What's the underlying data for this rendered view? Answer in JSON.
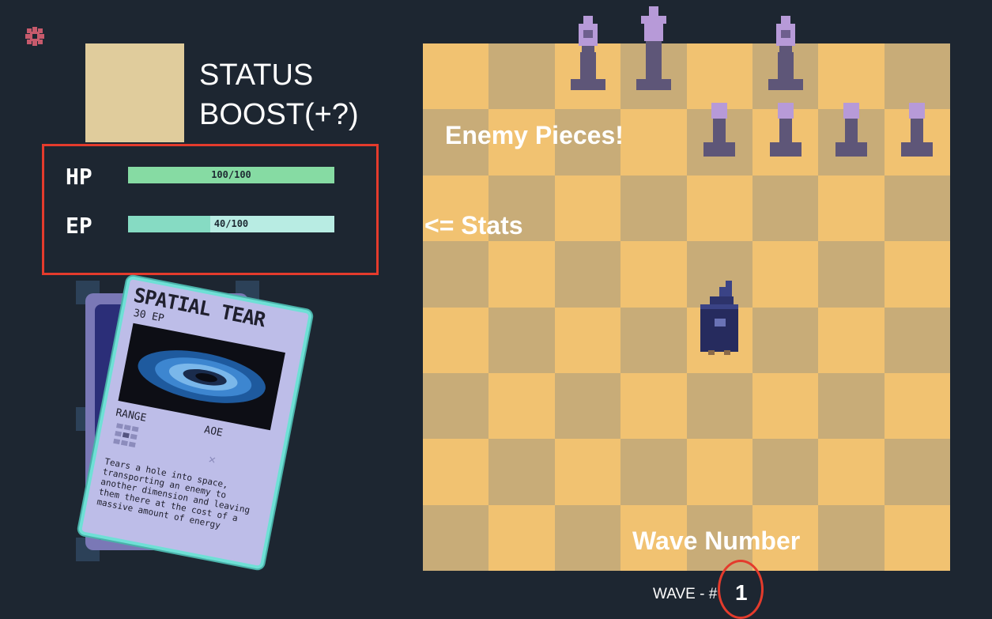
{
  "settings": {
    "icon": "gear-icon",
    "color": "#c75a6c"
  },
  "status_boost": {
    "text": "STATUS BOOST(+?)",
    "swatch_color": "#e0cc9c"
  },
  "stats": {
    "hp": {
      "label": "HP",
      "value": 100,
      "max": 100,
      "text": "100/100",
      "fraction": 1.0,
      "color": "#86dba3"
    },
    "ep": {
      "label": "EP",
      "value": 40,
      "max": 100,
      "text": "40/100",
      "fraction": 0.4,
      "color": "#86dbc3"
    }
  },
  "card": {
    "title": "SPATIAL TEAR",
    "cost": "30 EP",
    "range_label": "RANGE",
    "aoe_label": "AOE",
    "description": "Tears a hole into space, transporting an enemy to another dimension and leaving them there at the cost of a massive amount of energy"
  },
  "board": {
    "light_color": "#f1c271",
    "dark_color": "#c8ac78"
  },
  "annotations": {
    "enemy": "Enemy Pieces!",
    "stats": "<= Stats",
    "wave": "Wave Number"
  },
  "wave": {
    "label": "WAVE - #",
    "number": "1"
  }
}
